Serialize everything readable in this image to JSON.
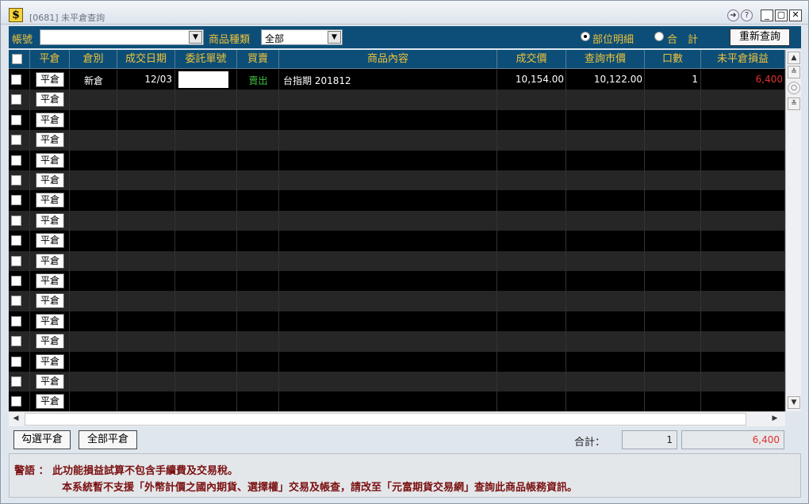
{
  "window": {
    "title": "[0681] 未平倉查詢",
    "icon_glyph": "$"
  },
  "toolbar": {
    "account_label": "帳號",
    "account_value": "",
    "product_label": "商品種類",
    "product_value": "全部",
    "radio_detail": "部位明細",
    "radio_total": "合　計",
    "refresh_label": "重新查詢"
  },
  "table": {
    "headers": [
      "",
      "平倉",
      "倉別",
      "成交日期",
      "委託單號",
      "買賣",
      "商品內容",
      "成交價",
      "查詢市價",
      "口數",
      "未平倉損益"
    ],
    "close_button_label": "平倉",
    "rows": [
      {
        "type": "新倉",
        "date": "12/03",
        "order_no": "",
        "side": "賣出",
        "product": "台指期 201812",
        "price": "10,154.00",
        "market": "10,122.00",
        "qty": "1",
        "pnl": "6,400"
      }
    ],
    "empty_rows": 16
  },
  "bottom": {
    "select_close_label": "勾選平倉",
    "close_all_label": "全部平倉",
    "total_label": "合計：",
    "total_qty": "1",
    "total_pnl": "6,400"
  },
  "warning": {
    "line1": "警語 ： 此功能損益試算不包含手續費及交易稅。",
    "line2": "本系統暫不支援「外幣計價之國內期貨、選擇權」交易及帳查，請改至「元富期貨交易網」查詢此商品帳務資訊。"
  },
  "colors": {
    "header_bg": "#0c4e77",
    "header_text": "#f0c23a",
    "sell": "#3fc23f",
    "pnl_positive": "#e03030"
  }
}
